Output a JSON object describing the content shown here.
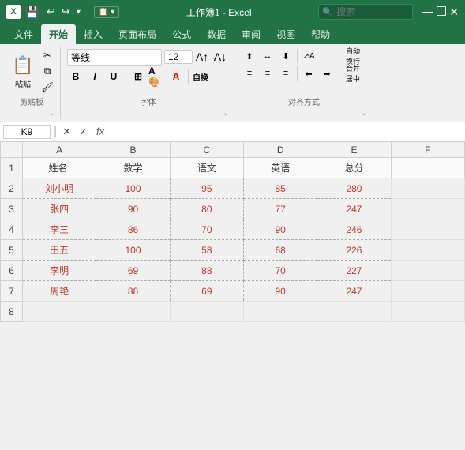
{
  "titleBar": {
    "logo": "X",
    "title": "工作簿1 - Excel",
    "searchPlaceholder": "搜索",
    "undoLabel": "↩",
    "redoLabel": "↪",
    "saveLabel": "💾"
  },
  "ribbonTabs": [
    "文件",
    "开始",
    "插入",
    "页面布局",
    "公式",
    "数据",
    "审阅",
    "视图",
    "帮助"
  ],
  "activeTab": "开始",
  "ribbon": {
    "pasteLabel": "粘贴",
    "cutLabel": "✂",
    "copyLabel": "⧉",
    "formatLabel": "🖌",
    "clipboardLabel": "剪贴板",
    "fontName": "等线",
    "fontSize": "12",
    "fontGroupLabel": "字体",
    "boldLabel": "B",
    "italicLabel": "I",
    "underlineLabel": "U",
    "alignGroupLabel": "对齐方式"
  },
  "formulaBar": {
    "nameBox": "K9",
    "cancelLabel": "✕",
    "confirmLabel": "✓",
    "fxLabel": "fx"
  },
  "columns": [
    "A",
    "B",
    "C",
    "D",
    "E",
    "F"
  ],
  "rows": [
    {
      "num": "1",
      "cells": [
        "姓名:",
        "数学",
        "语文",
        "英语",
        "总分",
        ""
      ]
    },
    {
      "num": "2",
      "cells": [
        "刘小明",
        "100",
        "95",
        "85",
        "280",
        ""
      ]
    },
    {
      "num": "3",
      "cells": [
        "张四",
        "90",
        "80",
        "77",
        "247",
        ""
      ]
    },
    {
      "num": "4",
      "cells": [
        "李三",
        "86",
        "70",
        "90",
        "246",
        ""
      ]
    },
    {
      "num": "5",
      "cells": [
        "王五",
        "100",
        "58",
        "68",
        "226",
        ""
      ]
    },
    {
      "num": "6",
      "cells": [
        "李明",
        "69",
        "88",
        "70",
        "227",
        ""
      ]
    },
    {
      "num": "7",
      "cells": [
        "周艳",
        "88",
        "69",
        "90",
        "247",
        ""
      ]
    },
    {
      "num": "8",
      "cells": [
        "",
        "",
        "",
        "",
        "",
        ""
      ]
    }
  ]
}
